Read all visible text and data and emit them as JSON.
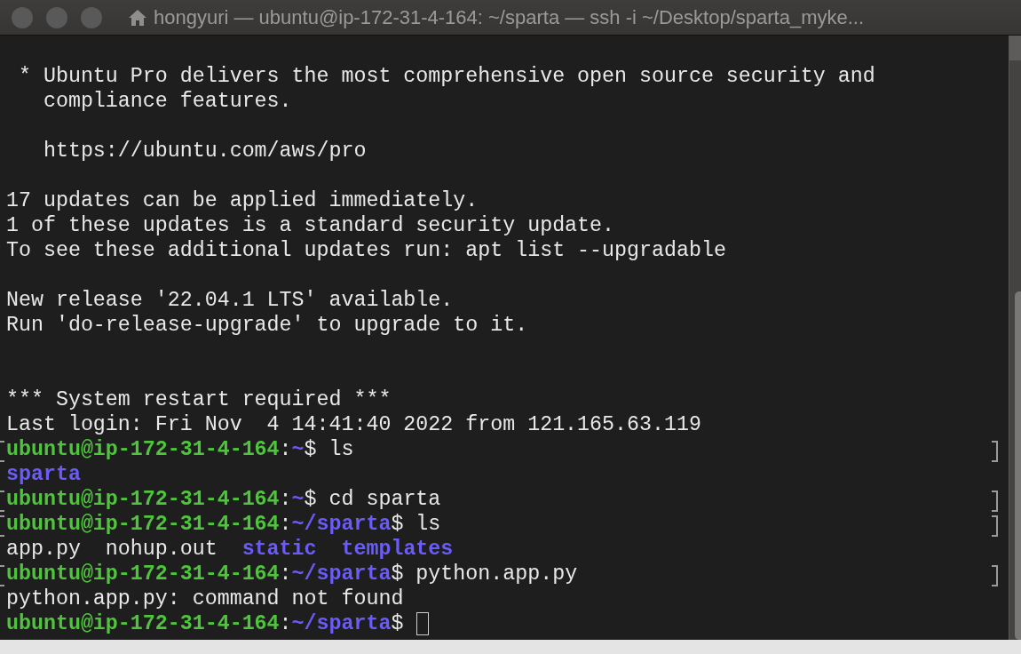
{
  "window": {
    "title": "hongyuri — ubuntu@ip-172-31-4-164: ~/sparta — ssh -i ~/Desktop/sparta_myke...",
    "active": false
  },
  "lines": [
    {
      "kind": "blank"
    },
    {
      "kind": "output",
      "segments": [
        {
          "text": " * Ubuntu Pro delivers the most comprehensive open source security and",
          "kind": "plain"
        }
      ]
    },
    {
      "kind": "output",
      "segments": [
        {
          "text": "   compliance features.",
          "kind": "plain"
        }
      ]
    },
    {
      "kind": "blank"
    },
    {
      "kind": "output",
      "segments": [
        {
          "text": "   https://ubuntu.com/aws/pro",
          "kind": "plain"
        }
      ]
    },
    {
      "kind": "blank"
    },
    {
      "kind": "output",
      "segments": [
        {
          "text": "17 updates can be applied immediately.",
          "kind": "plain"
        }
      ]
    },
    {
      "kind": "output",
      "segments": [
        {
          "text": "1 of these updates is a standard security update.",
          "kind": "plain"
        }
      ]
    },
    {
      "kind": "output",
      "segments": [
        {
          "text": "To see these additional updates run: apt list --upgradable",
          "kind": "plain"
        }
      ]
    },
    {
      "kind": "blank"
    },
    {
      "kind": "output",
      "segments": [
        {
          "text": "New release '22.04.1 LTS' available.",
          "kind": "plain"
        }
      ]
    },
    {
      "kind": "output",
      "segments": [
        {
          "text": "Run 'do-release-upgrade' to upgrade to it.",
          "kind": "plain"
        }
      ]
    },
    {
      "kind": "blank"
    },
    {
      "kind": "blank"
    },
    {
      "kind": "output",
      "segments": [
        {
          "text": "*** System restart required ***",
          "kind": "plain"
        }
      ]
    },
    {
      "kind": "output",
      "segments": [
        {
          "text": "Last login: Fri Nov  4 14:41:40 2022 from 121.165.63.119",
          "kind": "plain"
        }
      ]
    },
    {
      "kind": "prompt",
      "marked": true,
      "segments": [
        {
          "text": "ubuntu@ip-172-31-4-164",
          "kind": "user"
        },
        {
          "text": ":",
          "kind": "plain"
        },
        {
          "text": "~",
          "kind": "path"
        },
        {
          "text": "$ ls",
          "kind": "plain"
        }
      ]
    },
    {
      "kind": "output",
      "segments": [
        {
          "text": "sparta",
          "kind": "dir"
        }
      ]
    },
    {
      "kind": "prompt",
      "marked": true,
      "segments": [
        {
          "text": "ubuntu@ip-172-31-4-164",
          "kind": "user"
        },
        {
          "text": ":",
          "kind": "plain"
        },
        {
          "text": "~",
          "kind": "path"
        },
        {
          "text": "$ cd sparta",
          "kind": "plain"
        }
      ]
    },
    {
      "kind": "prompt",
      "marked": true,
      "segments": [
        {
          "text": "ubuntu@ip-172-31-4-164",
          "kind": "user"
        },
        {
          "text": ":",
          "kind": "plain"
        },
        {
          "text": "~/sparta",
          "kind": "path"
        },
        {
          "text": "$ ls",
          "kind": "plain"
        }
      ]
    },
    {
      "kind": "output",
      "segments": [
        {
          "text": "app.py  nohup.out  ",
          "kind": "plain"
        },
        {
          "text": "static  templates",
          "kind": "dir"
        }
      ]
    },
    {
      "kind": "prompt",
      "marked": true,
      "segments": [
        {
          "text": "ubuntu@ip-172-31-4-164",
          "kind": "user"
        },
        {
          "text": ":",
          "kind": "plain"
        },
        {
          "text": "~/sparta",
          "kind": "path"
        },
        {
          "text": "$ python.app.py",
          "kind": "plain"
        }
      ]
    },
    {
      "kind": "output",
      "segments": [
        {
          "text": "python.app.py: command not found",
          "kind": "plain"
        }
      ]
    },
    {
      "kind": "prompt",
      "marked": false,
      "cursor": true,
      "segments": [
        {
          "text": "ubuntu@ip-172-31-4-164",
          "kind": "user"
        },
        {
          "text": ":",
          "kind": "plain"
        },
        {
          "text": "~/sparta",
          "kind": "path"
        },
        {
          "text": "$ ",
          "kind": "plain"
        }
      ]
    }
  ]
}
